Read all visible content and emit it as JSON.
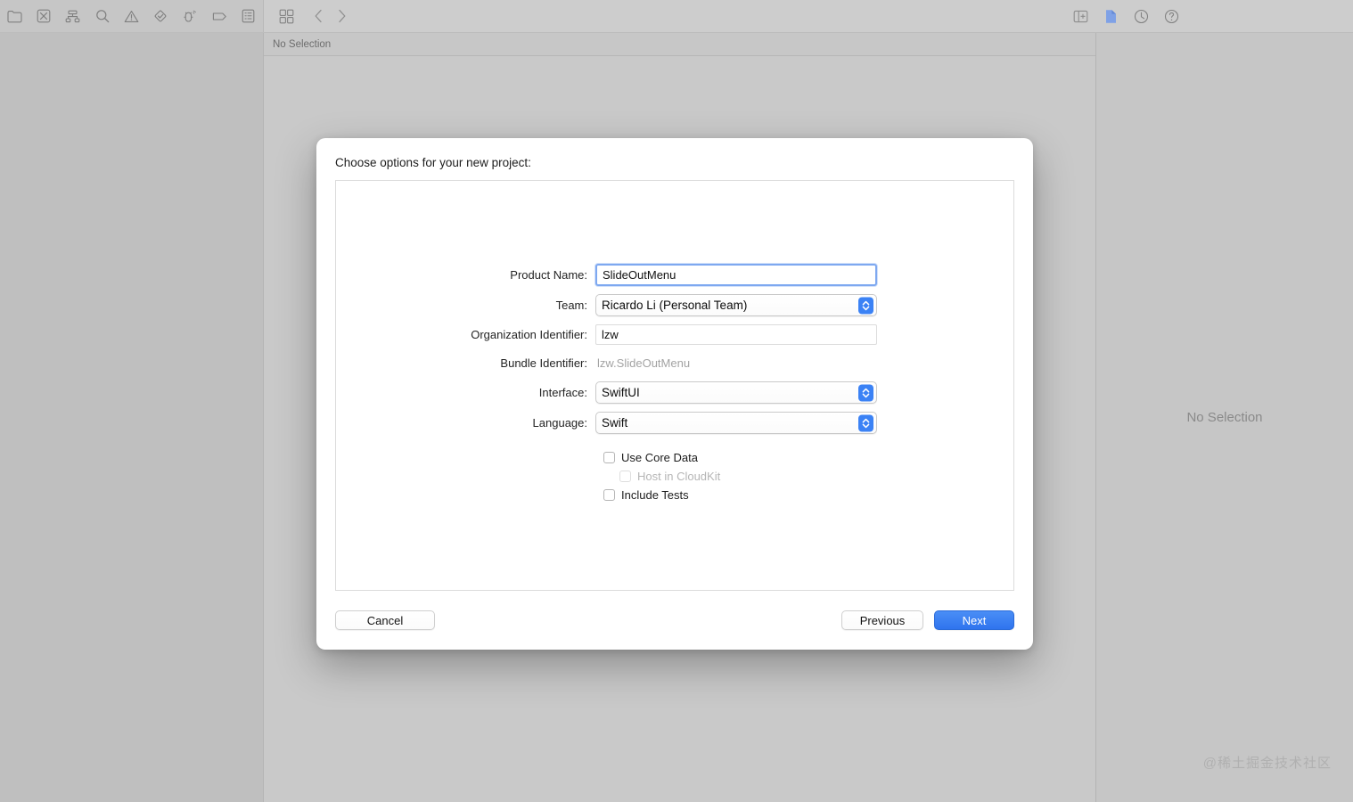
{
  "toolbar": {
    "left_icons": [
      {
        "name": "project-navigator-icon",
        "label": "Project Navigator"
      },
      {
        "name": "source-control-navigator-icon",
        "label": "Source Control Navigator"
      },
      {
        "name": "symbol-navigator-icon",
        "label": "Symbol Navigator"
      },
      {
        "name": "find-navigator-icon",
        "label": "Find Navigator"
      },
      {
        "name": "issue-navigator-icon",
        "label": "Issue Navigator"
      },
      {
        "name": "test-navigator-icon",
        "label": "Test Navigator"
      },
      {
        "name": "debug-navigator-icon",
        "label": "Debug Navigator"
      },
      {
        "name": "breakpoint-navigator-icon",
        "label": "Breakpoint Navigator"
      },
      {
        "name": "report-navigator-icon",
        "label": "Report Navigator"
      }
    ],
    "editor_mode_icon": "editor-mode-grid-icon",
    "back_icon": "chevron-left-icon",
    "forward_icon": "chevron-right-icon",
    "add_editor_icon": "add-editor-icon",
    "right_icons": [
      {
        "name": "file-inspector-icon",
        "label": "File Inspector"
      },
      {
        "name": "history-inspector-icon",
        "label": "History Inspector"
      },
      {
        "name": "help-inspector-icon",
        "label": "Quick Help Inspector"
      }
    ]
  },
  "jump_bar": {
    "breadcrumb": "No Selection"
  },
  "inspector": {
    "empty_text": "No Selection"
  },
  "watermark": {
    "text": "@稀土掘金技术社区"
  },
  "dialog": {
    "title": "Choose options for your new project:",
    "fields": [
      {
        "label": "Product Name:",
        "value": "SlideOutMenu",
        "type": "text",
        "focused": true
      },
      {
        "label": "Team:",
        "value": "Ricardo Li (Personal Team)",
        "type": "popup"
      },
      {
        "label": "Organization Identifier:",
        "value": "lzw",
        "type": "text",
        "focused": false
      },
      {
        "label": "Bundle Identifier:",
        "value": "lzw.SlideOutMenu",
        "type": "static"
      },
      {
        "label": "Interface:",
        "value": "SwiftUI",
        "type": "popup"
      },
      {
        "label": "Language:",
        "value": "Swift",
        "type": "popup"
      }
    ],
    "checkboxes": [
      {
        "label": "Use Core Data",
        "checked": false,
        "disabled": false,
        "indent": false
      },
      {
        "label": "Host in CloudKit",
        "checked": false,
        "disabled": true,
        "indent": true
      },
      {
        "label": "Include Tests",
        "checked": false,
        "disabled": false,
        "indent": false
      }
    ],
    "buttons": {
      "cancel": "Cancel",
      "previous": "Previous",
      "next": "Next"
    }
  },
  "colors": {
    "accent_blue": "#3b82f5",
    "focus_ring": "#7ea8f0",
    "window_gray": "#c9c9c9",
    "sheet_white": "#ffffff"
  }
}
